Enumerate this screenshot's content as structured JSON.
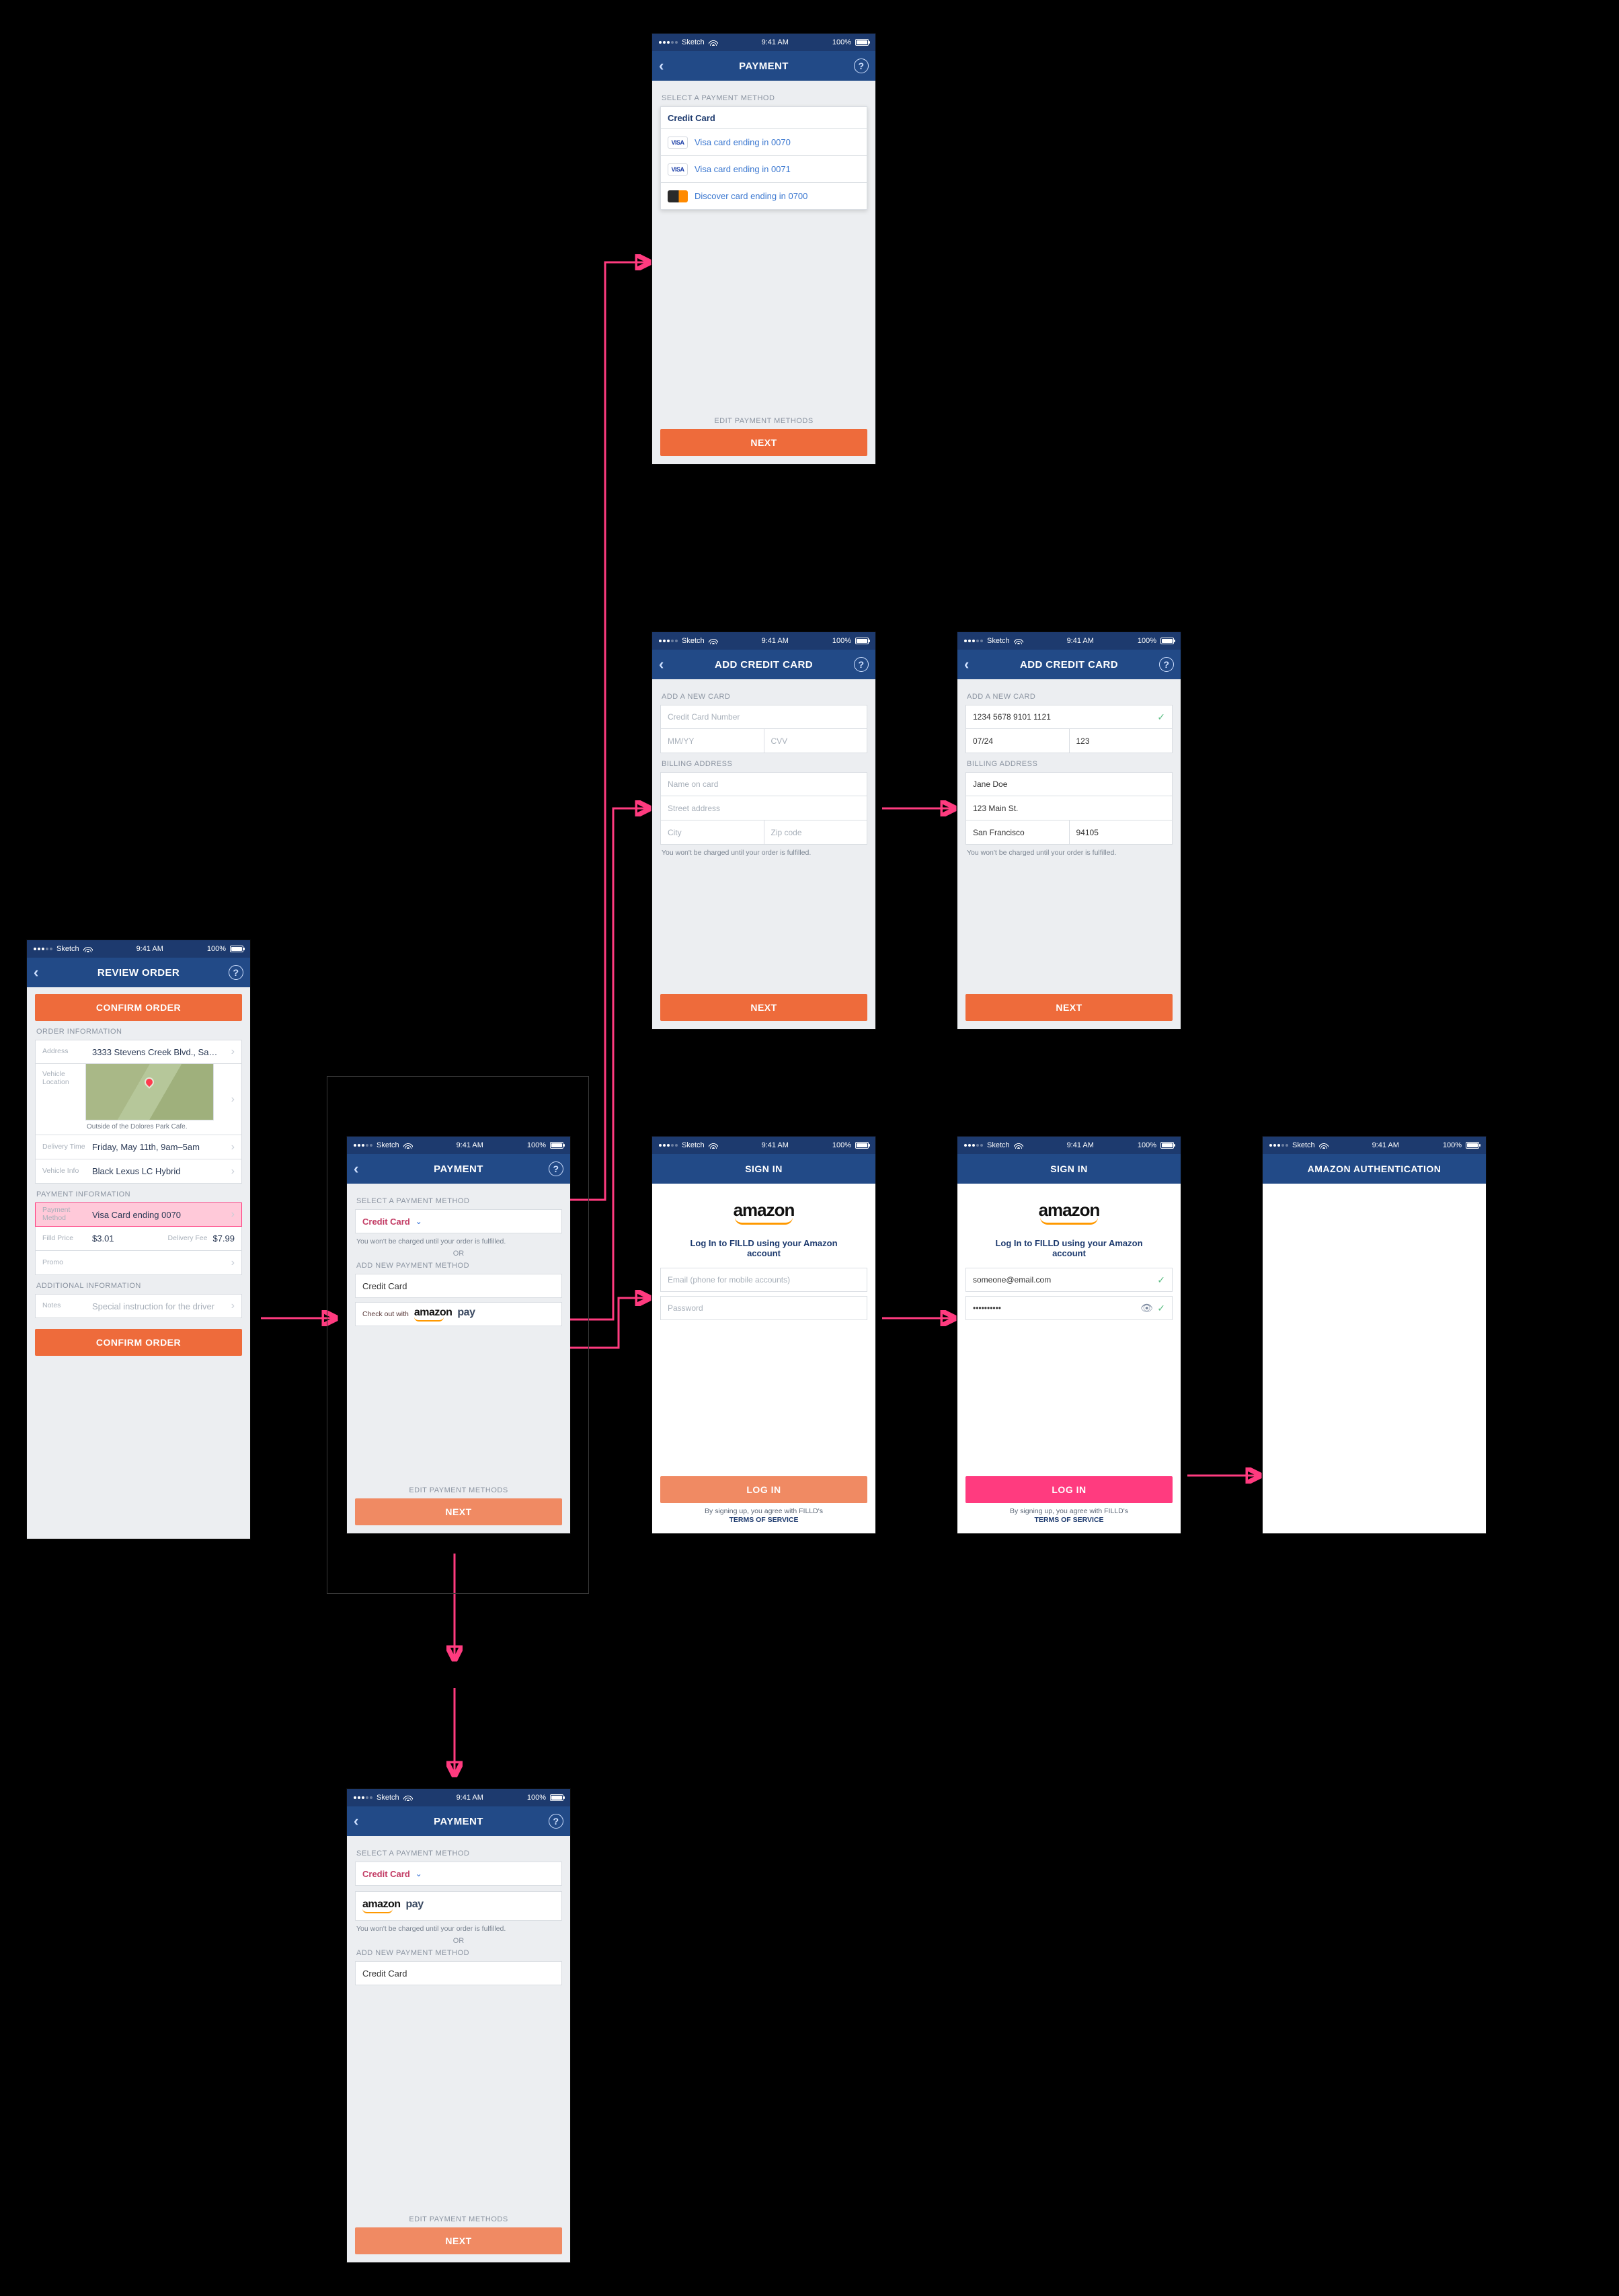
{
  "status": {
    "carrier": "Sketch",
    "time": "9:41 AM",
    "battery": "100%"
  },
  "common": {
    "back": "‹",
    "help": "?",
    "next": "NEXT",
    "editPay": "EDIT PAYMENT METHODS",
    "selectMethod": "SELECT A PAYMENT METHOD",
    "addMethod": "ADD NEW PAYMENT METHOD",
    "notCharged": "You won't be charged until your order is fulfilled.",
    "or": "OR",
    "amazonPay": "amazon pay",
    "amazon": "amazon"
  },
  "review": {
    "title": "REVIEW ORDER",
    "confirm": "CONFIRM ORDER",
    "orderInfo": "ORDER INFORMATION",
    "addressLabel": "Address",
    "address": "3333 Stevens Creek Blvd., Sa…",
    "caption": "Outside of the Dolores Park Cafe.",
    "vehLocLabel": "Vehicle Location",
    "timeLabel": "Delivery Time",
    "time": "Friday, May 11th, 9am–5am",
    "vehInfoLabel": "Vehicle Info",
    "veh": "Black Lexus LC Hybrid",
    "payInfo": "PAYMENT INFORMATION",
    "payMethodLabel": "Payment Method",
    "payMethod": "Visa Card ending 0070",
    "priceLabel": "Filld Price",
    "price": "$3.01",
    "feeLabel": "Delivery Fee",
    "fee": "$7.99",
    "promoLabel": "Promo",
    "addlInfo": "ADDITIONAL INFORMATION",
    "notesLabel": "Notes",
    "notesPH": "Special instruction for the driver"
  },
  "payMain": {
    "title": "PAYMENT",
    "creditCard": "Credit Card",
    "checkoutWith": "Check out with"
  },
  "paySaved": {
    "title": "PAYMENT",
    "listTitle": "Credit Card",
    "visa": "VISA",
    "items": [
      "Visa card ending in 0070",
      "Visa card ending in 0071",
      "Discover card ending in 0700"
    ]
  },
  "addCard": {
    "title": "ADD CREDIT CARD",
    "newCard": "ADD A NEW CARD",
    "ccNum": "Credit Card Number",
    "mmyy": "MM/YY",
    "cvv": "CVV",
    "billing": "BILLING ADDRESS",
    "name": "Name on card",
    "street": "Street address",
    "city": "City",
    "zip": "Zip code",
    "filled": {
      "cc": "1234 5678 9101 1121",
      "mmyy": "07/24",
      "cvv": "123",
      "name": "Jane Doe",
      "street": "123 Main St.",
      "city": "San Francisco",
      "zip": "94105"
    }
  },
  "signin": {
    "title": "SIGN IN",
    "sub": "Log In to FILLD using your Amazon account",
    "emailPH": "Email (phone for mobile accounts)",
    "passPH": "Password",
    "email": "someone@email.com",
    "passMasked": "••••••••••",
    "login": "LOG IN",
    "terms1": "By signing up, you agree with FILLD's",
    "terms2": "TERMS OF SERVICE"
  },
  "amazonAuth": {
    "title": "AMAZON AUTHENTICATION"
  },
  "payAmz": {
    "title": "PAYMENT"
  }
}
